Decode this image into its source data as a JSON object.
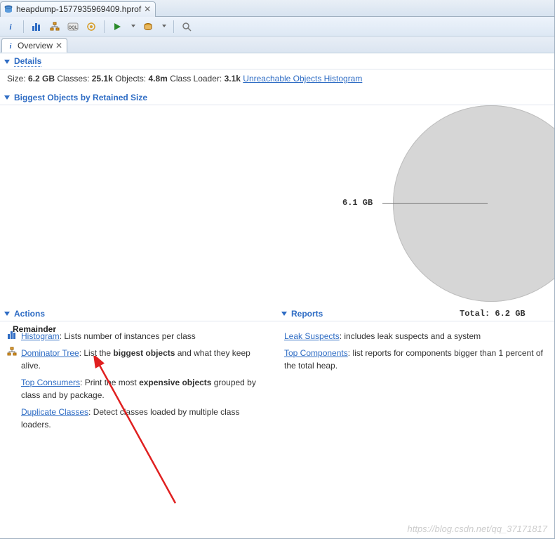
{
  "editor_tab": {
    "title": "heapdump-1577935969409.hprof"
  },
  "inner_tab": {
    "title": "Overview"
  },
  "details": {
    "header": "Details",
    "size_label": "Size:",
    "size_value": "6.2 GB",
    "classes_label": "Classes:",
    "classes_value": "25.1k",
    "objects_label": "Objects:",
    "objects_value": "4.8m",
    "classloader_label": "Class Loader:",
    "classloader_value": "3.1k",
    "unreachable_link": "Unreachable Objects Histogram"
  },
  "biggest": {
    "header": "Biggest Objects by Retained Size",
    "slice_label": "6.1 GB",
    "total_label": "Total: 6.2 GB",
    "remainder": "Remainder"
  },
  "actions": {
    "header": "Actions",
    "histogram_link": "Histogram",
    "histogram_text": ": Lists number of instances per class",
    "dominator_link": "Dominator Tree",
    "dominator_pre": ": List the ",
    "dominator_bold": "biggest objects",
    "dominator_post": " and what they keep alive.",
    "topcons_link": "Top Consumers",
    "topcons_pre": ": Print the most ",
    "topcons_bold": "expensive objects",
    "topcons_post": " grouped by class and by package.",
    "dupcls_link": "Duplicate Classes",
    "dupcls_text": ": Detect classes loaded by multiple class loaders."
  },
  "reports": {
    "header": "Reports",
    "leak_link": "Leak Suspects",
    "leak_text": ": includes leak suspects and a system",
    "topcomp_link": "Top Components",
    "topcomp_text": ": list reports for components bigger than 1 percent of the total heap."
  },
  "chart_data": {
    "type": "pie",
    "title": "Biggest Objects by Retained Size",
    "total_label": "Total: 6.2 GB",
    "slices": [
      {
        "label": "6.1 GB",
        "value": 6.1
      },
      {
        "label": "Remainder",
        "value": 0.1
      }
    ],
    "total": 6.2,
    "unit": "GB"
  },
  "watermark": "https://blog.csdn.net/qq_37171817"
}
